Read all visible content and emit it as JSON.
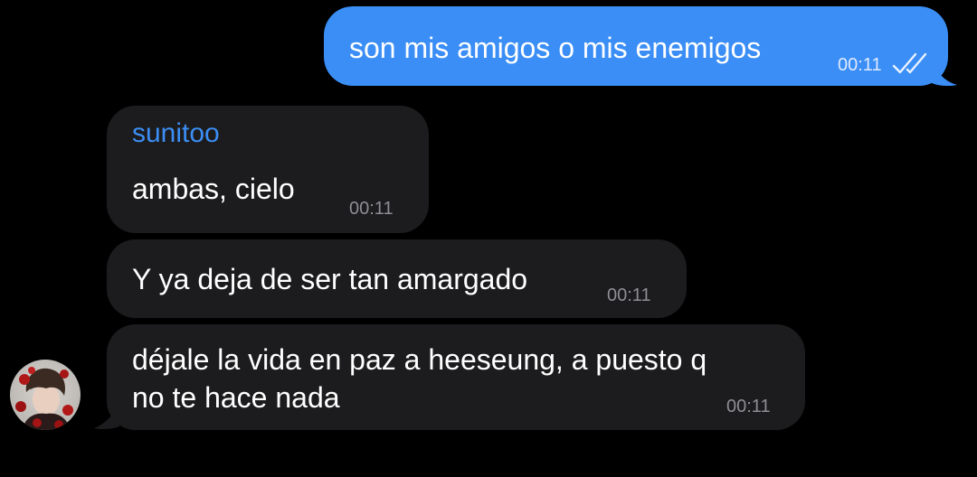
{
  "chat": {
    "messages": [
      {
        "direction": "outgoing",
        "text": "son mis amigos o mis enemigos",
        "time": "00:11",
        "status_icon": "double-check-icon"
      },
      {
        "direction": "incoming",
        "sender": "sunitoo",
        "text": "ambas, cielo",
        "time": "00:11"
      },
      {
        "direction": "incoming",
        "text": "Y ya deja de ser tan amargado",
        "time": "00:11"
      },
      {
        "direction": "incoming",
        "text_lines": [
          "déjale la vida en paz a heeseung, a puesto q",
          "no te hace nada"
        ],
        "time": "00:11"
      }
    ]
  },
  "colors": {
    "background": "#000000",
    "outgoing_bubble": "#3a8ef6",
    "incoming_bubble": "#1c1c1e",
    "sender_name": "#3c8ef5",
    "timestamp_incoming": "#8e8e93"
  }
}
